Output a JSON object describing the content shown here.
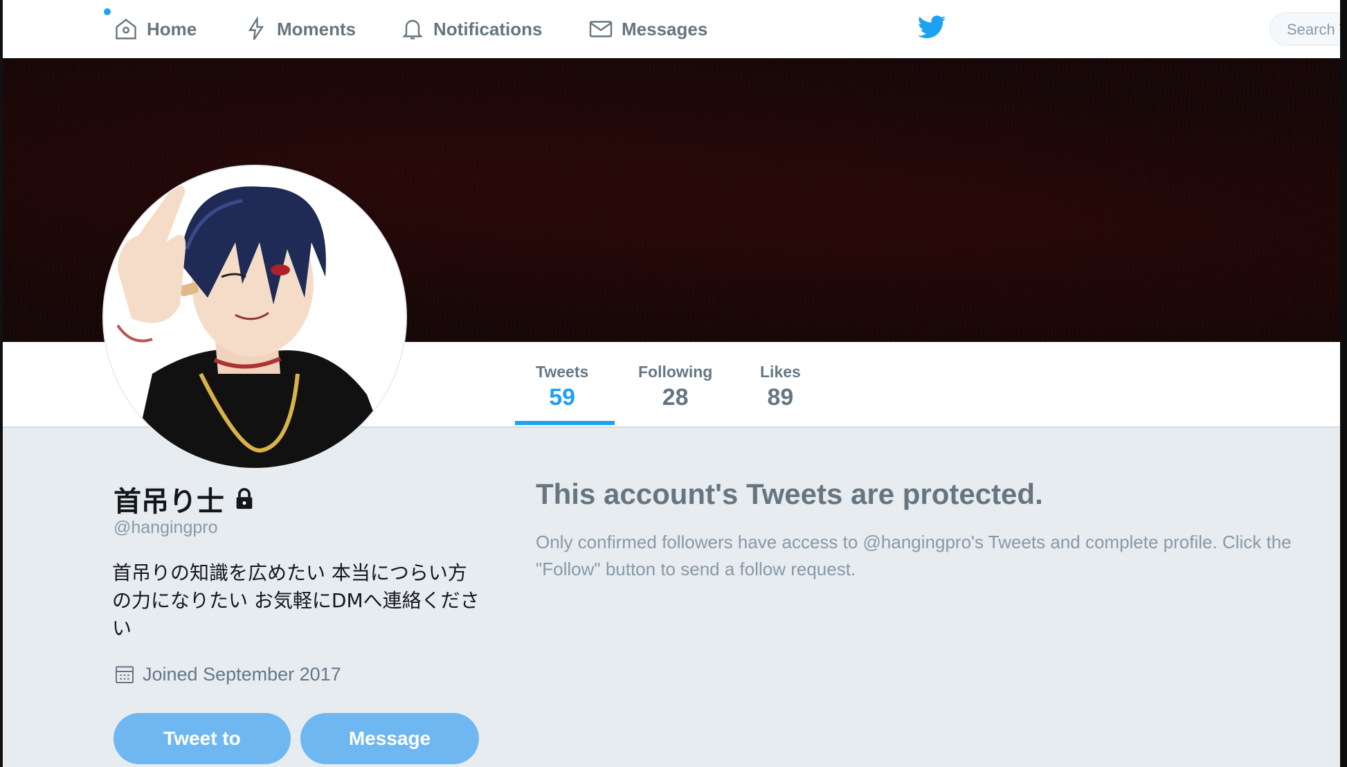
{
  "nav": {
    "items": [
      {
        "label": "Home",
        "icon": "home-icon"
      },
      {
        "label": "Moments",
        "icon": "lightning-icon"
      },
      {
        "label": "Notifications",
        "icon": "bell-icon"
      },
      {
        "label": "Messages",
        "icon": "envelope-icon"
      }
    ],
    "logo": "twitter-bird-icon",
    "search_placeholder": "Search T"
  },
  "profile": {
    "name": "首吊り士",
    "handle": "@hangingpro",
    "bio": "首吊りの知識を広めたい 本当につらい方の力になりたい お気軽にDMへ連絡ください",
    "joined": "Joined September 2017",
    "stats": [
      {
        "label": "Tweets",
        "value": "59"
      },
      {
        "label": "Following",
        "value": "28"
      },
      {
        "label": "Likes",
        "value": "89"
      }
    ],
    "buttons": {
      "tweet_to": "Tweet to",
      "message": "Message"
    }
  },
  "protected": {
    "title": "This account's Tweets are protected.",
    "text": "Only confirmed followers have access to @hangingpro's Tweets and complete profile. Click the \"Follow\" button to send a follow request."
  },
  "colors": {
    "accent": "#1da1f2",
    "button": "#6fb7f0",
    "background": "#e6ecf0"
  }
}
